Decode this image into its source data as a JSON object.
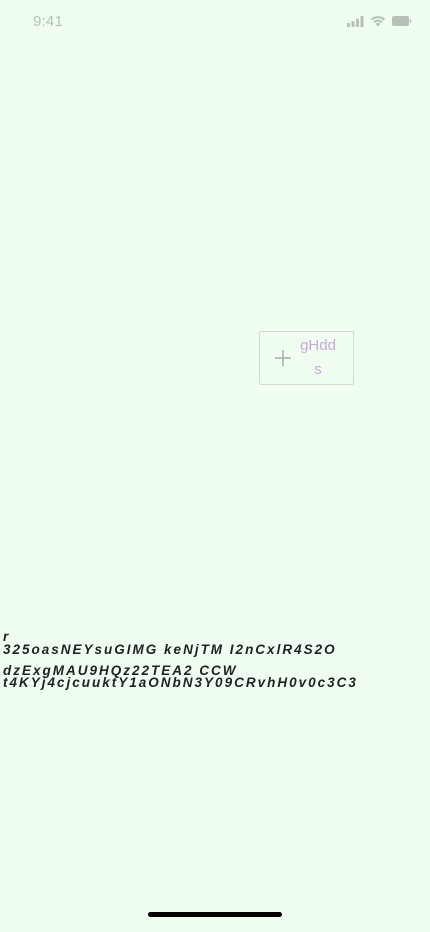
{
  "status_bar": {
    "time": "9:41",
    "icons": [
      "signal-icon",
      "wifi-icon",
      "battery-icon"
    ],
    "icon_color": "#b7c0b7"
  },
  "add_button": {
    "icon": "plus-icon",
    "label": "gHdds",
    "label_color": "#c8a9d8",
    "icon_color": "#b0b0b0"
  },
  "text_block": {
    "line1": "r",
    "line2": "325oasNEYsuGIMG keNjTM I2nCxlR4S2O",
    "line3": "dzExgMAU9HQz22TEA2 CCW",
    "line4": "t4KYj4cjcuuktY1aONbN3Y09CRvhH0v0c3C3"
  },
  "colors": {
    "background": "#effef0",
    "text": "#222222"
  }
}
